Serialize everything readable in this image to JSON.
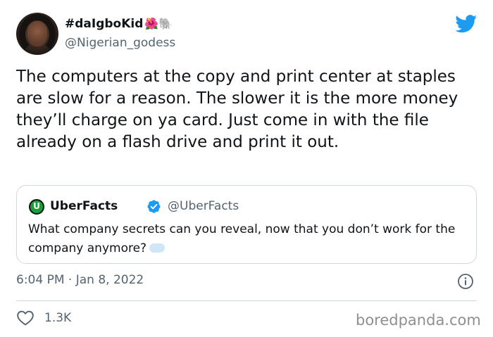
{
  "author": {
    "display_name": "#daIgboKid",
    "name_emojis": "🌺🐘",
    "handle": "@Nigerian_godess"
  },
  "tweet": {
    "text": "The computers at the copy and print center at staples are slow for a reason. The slower it is the more money they’ll charge on ya card. Just come in with the file already on a flash drive and print it out."
  },
  "quoted_tweet": {
    "logo_letter": "U",
    "display_name": "UberFacts",
    "handle": "@UberFacts",
    "text": "What company secrets can you reveal, now that you don’t work for the company anymore?"
  },
  "meta": {
    "timestamp": "6:04 PM · Jan 8, 2022"
  },
  "actions": {
    "like_count": "1.3K"
  },
  "watermark": "boredpanda.com",
  "colors": {
    "twitter_blue": "#1d9bf0",
    "secondary_text": "#536471",
    "border": "#cfd9de"
  }
}
